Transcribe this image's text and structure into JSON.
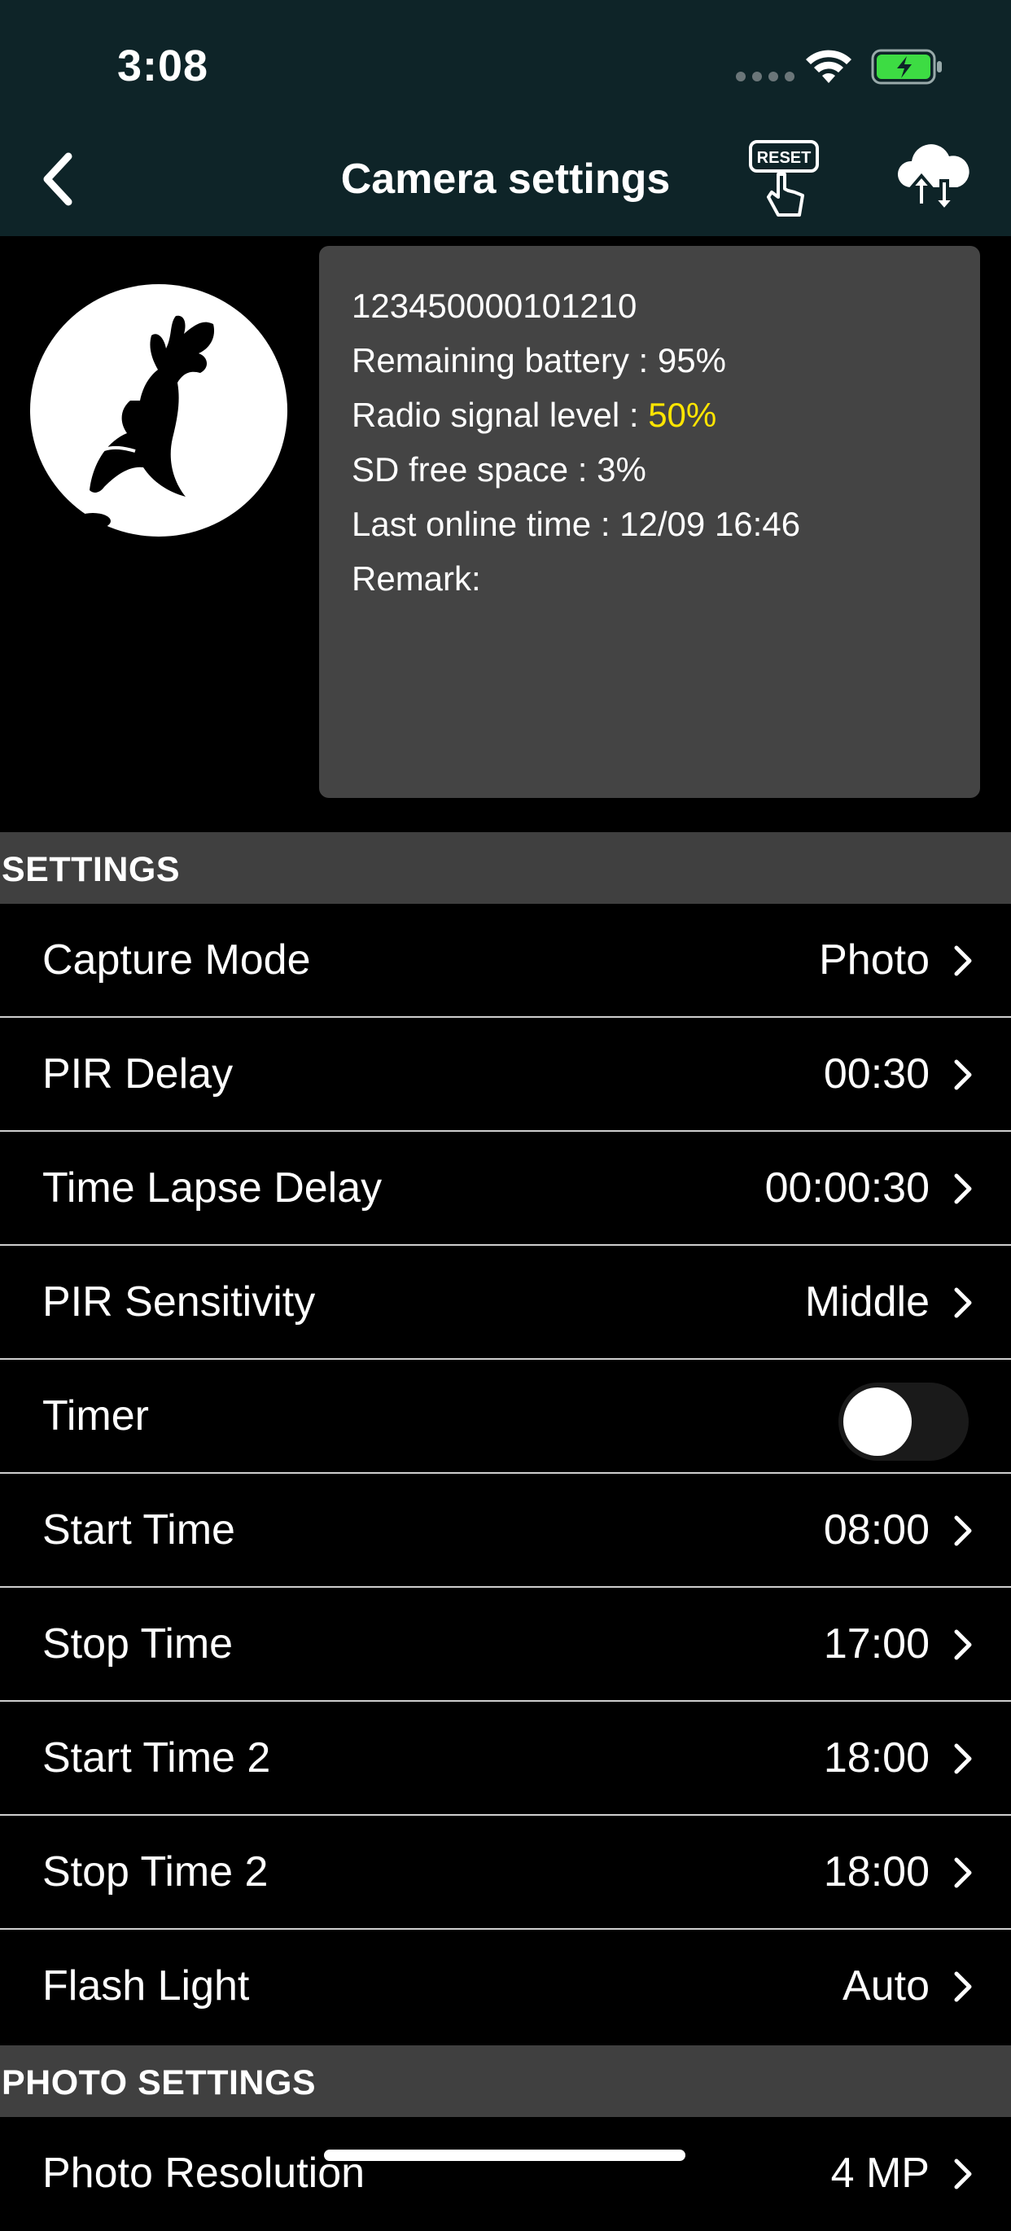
{
  "status_bar": {
    "time": "3:08"
  },
  "header": {
    "title": "Camera settings",
    "reset_icon_text": "RESET"
  },
  "device_info": {
    "serial": "123450000101210",
    "battery_label": "Remaining battery : ",
    "battery_value": "95%",
    "signal_label": "Radio signal level : ",
    "signal_value": "50%",
    "sd_label": "SD free space : ",
    "sd_value": "3%",
    "last_online_label": "Last online time : ",
    "last_online_value": "12/09 16:46",
    "remark_label": "Remark:"
  },
  "sections": {
    "settings": "SETTINGS",
    "photo_settings": "PHOTO SETTINGS"
  },
  "settings_rows": [
    {
      "label": "Capture Mode",
      "value": "Photo"
    },
    {
      "label": "PIR Delay",
      "value": "00:30"
    },
    {
      "label": "Time Lapse Delay",
      "value": "00:00:30"
    },
    {
      "label": "PIR Sensitivity",
      "value": "Middle"
    },
    {
      "label": "Timer",
      "toggle_on": false
    },
    {
      "label": "Start Time",
      "value": "08:00"
    },
    {
      "label": "Stop Time",
      "value": "17:00"
    },
    {
      "label": "Start Time 2",
      "value": "18:00"
    },
    {
      "label": "Stop Time 2",
      "value": "18:00"
    },
    {
      "label": "Flash Light",
      "value": "Auto"
    }
  ],
  "photo_rows": [
    {
      "label": "Photo Resolution",
      "value": "4 MP"
    }
  ],
  "colors": {
    "header_bg": "#0e2428",
    "signal_highlight": "#ffe500",
    "battery_green": "#3ddc43"
  }
}
